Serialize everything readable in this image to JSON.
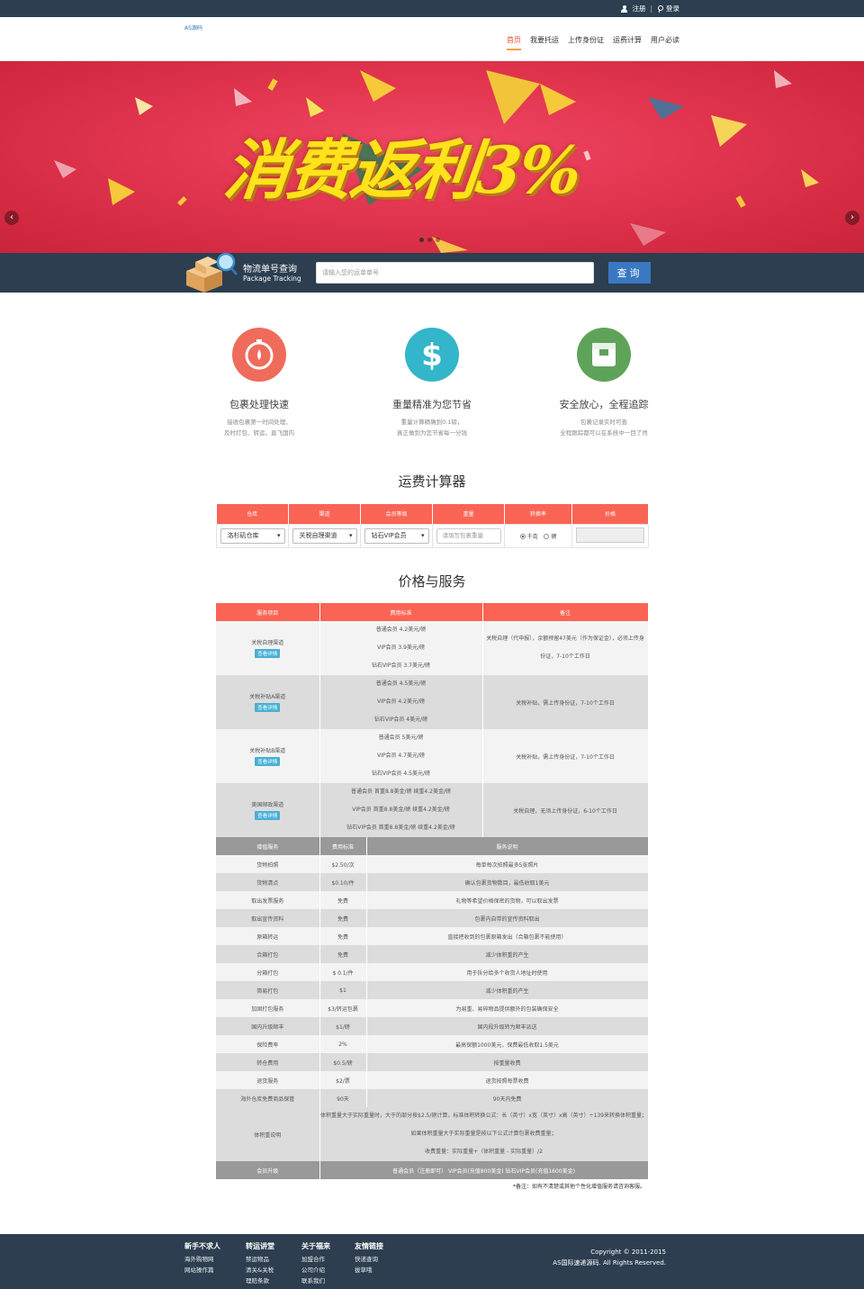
{
  "topbar": {
    "register": "注册",
    "separator": "|",
    "login": "登录"
  },
  "header": {
    "logo": "AS源码",
    "nav": [
      "首页",
      "我要托运",
      "上传身份证",
      "运费计算",
      "用户必读"
    ]
  },
  "banner": {
    "promo": "消费返利3%",
    "prev": "‹",
    "next": "›"
  },
  "tracking": {
    "title": "物流单号查询",
    "subtitle": "Package Tracking",
    "placeholder": "请输入您的运单单号",
    "button": "查询"
  },
  "features": [
    {
      "title": "包裹处理快速",
      "desc1": "接收包裹第一时间处理，",
      "desc2": "及时打包、转运，直飞国内",
      "color": "#ef6b5b",
      "icon": "stopwatch-icon"
    },
    {
      "title": "重量精准为您节省",
      "desc1": "重量计算精确到0.1磅，",
      "desc2": "真正做到为您节省每一分钱",
      "color": "#33b6c9",
      "icon": "dollar-icon"
    },
    {
      "title": "安全放心，全程追踪",
      "desc1": "包裹记录实时可查",
      "desc2": "全程跟踪都可以在系统中一目了然",
      "color": "#5fa35a",
      "icon": "package-icon"
    }
  ],
  "calculator": {
    "title": "运费计算器",
    "headers": [
      "仓库",
      "渠道",
      "会员等级",
      "重量",
      "转换率",
      "价格"
    ],
    "warehouse": "洛杉矶仓库",
    "channel": "关税自理渠道",
    "member": "钻石VIP会员",
    "weight_placeholder": "请填写包裹重量",
    "unit_kg": "千克",
    "unit_lb": "磅"
  },
  "pricing": {
    "title": "价格与服务",
    "headers": [
      "服务项目",
      "费用标准",
      "备注"
    ],
    "detail_label": "查看详情",
    "channels": [
      {
        "name": "关税自理渠道",
        "fees": [
          "普通会员 4.2美元/磅",
          "VIP会员 3.9美元/磅",
          "钻石VIP会员 3.7美元/磅"
        ],
        "note1": "关税自理（代申报），余额预留47美元（作为保证金），必须上传身",
        "note2": "份证，7-10个工作日"
      },
      {
        "name": "关税补贴A渠道",
        "fees": [
          "普通会员 4.5美元/磅",
          "VIP会员 4.2美元/磅",
          "钻石VIP会员 4美元/磅"
        ],
        "note1": "关税补贴，需上传身份证，7-10个工作日",
        "note2": ""
      },
      {
        "name": "关税补贴B渠道",
        "fees": [
          "普通会员 5美元/磅",
          "VIP会员 4.7美元/磅",
          "钻石VIP会员 4.5美元/磅"
        ],
        "note1": "关税补贴，需上传身份证，7-10个工作日",
        "note2": ""
      },
      {
        "name": "美国邮政渠道",
        "fees": [
          "普通会员 首重8.8美金/磅 续重4.2美金/磅",
          "VIP会员 首重8.8美金/磅 续重4.2美金/磅",
          "钻石VIP会员 首重8.8美金/磅 续重4.2美金/磅"
        ],
        "note1": "关税自理，无须上传身份证，6-10个工作日",
        "note2": ""
      }
    ],
    "sub_headers": [
      "增值服务",
      "费用标准",
      "服务说明"
    ],
    "services": [
      {
        "name": "货物拍照",
        "fee": "$2.50/次",
        "desc": "每单每次拍照最多5张照片"
      },
      {
        "name": "货物清点",
        "fee": "$0.10/件",
        "desc": "确认包裹货物数目，最低收取1美元"
      },
      {
        "name": "取出发票服务",
        "fee": "免费",
        "desc": "礼物等希望价格保密的货物，可以取出发票"
      },
      {
        "name": "取出宣传资料",
        "fee": "免费",
        "desc": "包裹内自带的宣传资料取出"
      },
      {
        "name": "原箱转运",
        "fee": "免费",
        "desc": "直接把收到的包裹原箱发出（合箱包裹不能使用）"
      },
      {
        "name": "合箱打包",
        "fee": "免费",
        "desc": "减少体积重的产生"
      },
      {
        "name": "分箱打包",
        "fee": "$ 0.1/件",
        "desc": "用于拆分给多个收货人地址时使用"
      },
      {
        "name": "简易打包",
        "fee": "$1",
        "desc": "减少体积重的产生"
      },
      {
        "name": "加固打包服务",
        "fee": "$3/转运包裹",
        "desc": "为易重、易碎物品提供额外的包装确保安全"
      },
      {
        "name": "国内升级顺丰",
        "fee": "$1/磅",
        "desc": "国内段升级转为顺丰派送"
      },
      {
        "name": "保险费率",
        "fee": "2%",
        "desc": "最高保额1000美元，保费最低收取1.5美元"
      },
      {
        "name": "转仓费用",
        "fee": "$0.5/磅",
        "desc": "按重量收费"
      },
      {
        "name": "退货服务",
        "fee": "$2/票",
        "desc": "退货按照每票收费"
      },
      {
        "name": "海外仓库免费商品保管",
        "fee": "90天",
        "desc": "90天内免费"
      }
    ],
    "volume": {
      "name": "体积重说明",
      "lines": [
        "体积重量大于实际重量时，大于的部分按$2.5/磅计算，标准体积转换公式：长（英寸）x宽（英寸）x高（英寸）÷139来转换体积重量；",
        "如果体积重量大于实际重量是按以下公式计算包裹收费重量；",
        "收费重量：实际重量+（体积重量 - 实际重量）/2"
      ]
    },
    "upgrade": {
      "name": "会员升级",
      "desc": "普通会员（注册即可）   VIP会员(充值800美金)    钻石VIP会员(充值1600美金)"
    },
    "note": "*备注：如有不清楚或其他个性化增值服务请咨询客服。"
  },
  "footer": {
    "cols": [
      {
        "title": "新手不求人",
        "items": [
          "海外购物网",
          "网站操作篇"
        ]
      },
      {
        "title": "转运讲堂",
        "items": [
          "禁运物品",
          "清关&关税",
          "理赔条款"
        ]
      },
      {
        "title": "关于福来",
        "items": [
          "加盟合作",
          "公司介绍",
          "联系我们"
        ]
      },
      {
        "title": "友情链接",
        "items": [
          "快递查询",
          "拔草哦"
        ]
      }
    ],
    "copyright": "Copyright © 2011-2015",
    "rights": "AS国际速递源码. All Rights Reserved."
  },
  "colors": {
    "dark": "#2c3e50",
    "accent": "#fa6455",
    "button": "#3a78c2",
    "tag": "#48b0d5"
  }
}
